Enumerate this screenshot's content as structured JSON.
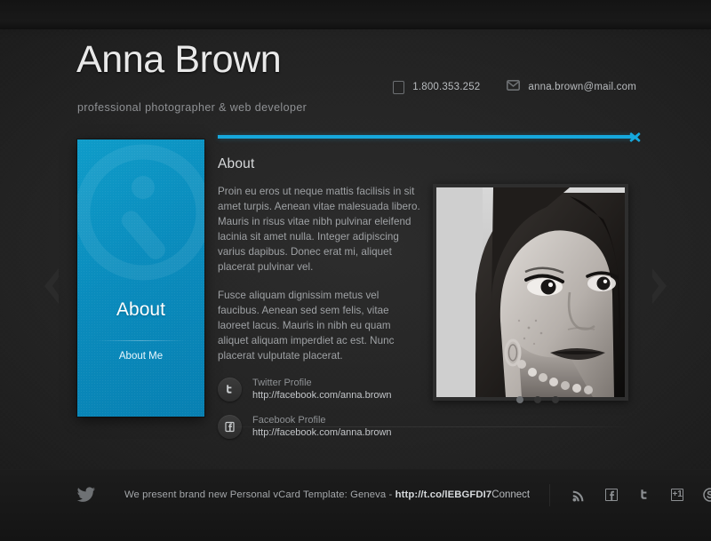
{
  "header": {
    "name": "Anna Brown",
    "tagline": "professional photographer & web developer",
    "phone": "1.800.353.252",
    "email": "anna.brown@mail.com",
    "phone_icon": "mobile-phone-icon",
    "email_icon": "envelope-icon"
  },
  "sidebar_card": {
    "title": "About",
    "subtitle": "About Me",
    "watermark_icon": "info-circle-icon",
    "accent_color": "#0a8cbd"
  },
  "nav": {
    "prev_icon": "chevron-left-icon",
    "next_icon": "chevron-right-icon"
  },
  "main": {
    "accent_color": "#16a8dd",
    "close_icon": "close-x-icon",
    "section_title": "About",
    "paragraphs": [
      "Proin eu eros ut neque mattis facilisis in sit amet turpis. Aenean vitae malesuada libero. Mauris in risus vitae nibh pulvinar eleifend lacinia sit amet nulla. Integer adipiscing varius dapibus. Donec erat mi, aliquet placerat pulvinar vel.",
      "Fusce aliquam dignissim metus vel faucibus. Aenean sed sem felis, vitae laoreet lacus. Mauris in nibh eu quam aliquet aliquam imperdiet ac est. Nunc placerat vulputate placerat."
    ],
    "profiles": [
      {
        "icon": "twitter-icon",
        "glyph": "t",
        "name": "Twitter Profile",
        "url": "http://facebook.com/anna.brown"
      },
      {
        "icon": "facebook-icon",
        "glyph": "f",
        "name": "Facebook Profile",
        "url": "http://facebook.com/anna.brown"
      }
    ],
    "photo_alt": "black-and-white portrait photograph",
    "pager": {
      "count": 3,
      "active": 0
    }
  },
  "footer": {
    "twitter_icon": "twitter-bird-icon",
    "tweet_prefix": "We present brand new Personal vCard Template: Geneva - ",
    "tweet_link": "http://t.co/lEBGFDI7",
    "connect_label": "Connect",
    "social": [
      {
        "icon": "rss-icon",
        "glyph": ""
      },
      {
        "icon": "facebook-icon",
        "glyph": "f"
      },
      {
        "icon": "twitter-icon",
        "glyph": "t"
      },
      {
        "icon": "google-plus-one-icon",
        "glyph": "+1"
      },
      {
        "icon": "skype-icon",
        "glyph": "S"
      }
    ]
  }
}
